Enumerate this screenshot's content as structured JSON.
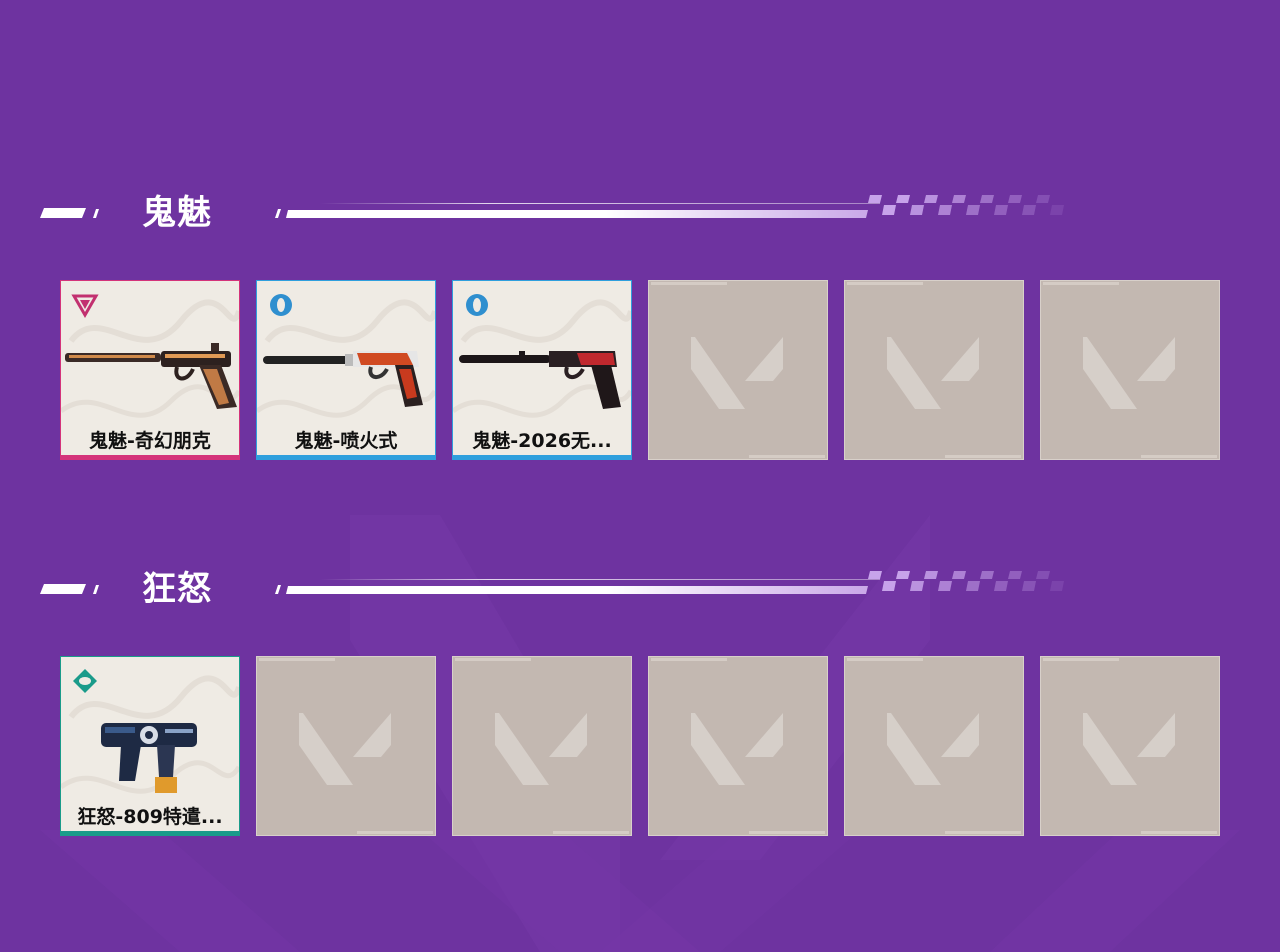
{
  "colors": {
    "background": "#6e33a0",
    "exclusive": "#d4337a",
    "premium": "#2f9fdd",
    "select": "#1a9b8a",
    "empty_slot": "#c3b8b1"
  },
  "sections": [
    {
      "title": "鬼魅",
      "items": [
        {
          "name": "鬼魅-奇幻朋克",
          "tier": "exclusive",
          "icon": "triangle-tier-icon",
          "rarity_color": "#d4337a"
        },
        {
          "name": "鬼魅-喷火式",
          "tier": "premium",
          "icon": "ring-tier-icon",
          "rarity_color": "#2f9fdd"
        },
        {
          "name": "鬼魅-2026无...",
          "tier": "premium",
          "icon": "ring-tier-icon",
          "rarity_color": "#2f9fdd"
        },
        {
          "empty": true
        },
        {
          "empty": true
        },
        {
          "empty": true
        }
      ]
    },
    {
      "title": "狂怒",
      "items": [
        {
          "name": "狂怒-809特遣...",
          "tier": "select",
          "icon": "diamond-tier-icon",
          "rarity_color": "#1a9b8a"
        },
        {
          "empty": true
        },
        {
          "empty": true
        },
        {
          "empty": true
        },
        {
          "empty": true
        },
        {
          "empty": true
        }
      ]
    }
  ]
}
